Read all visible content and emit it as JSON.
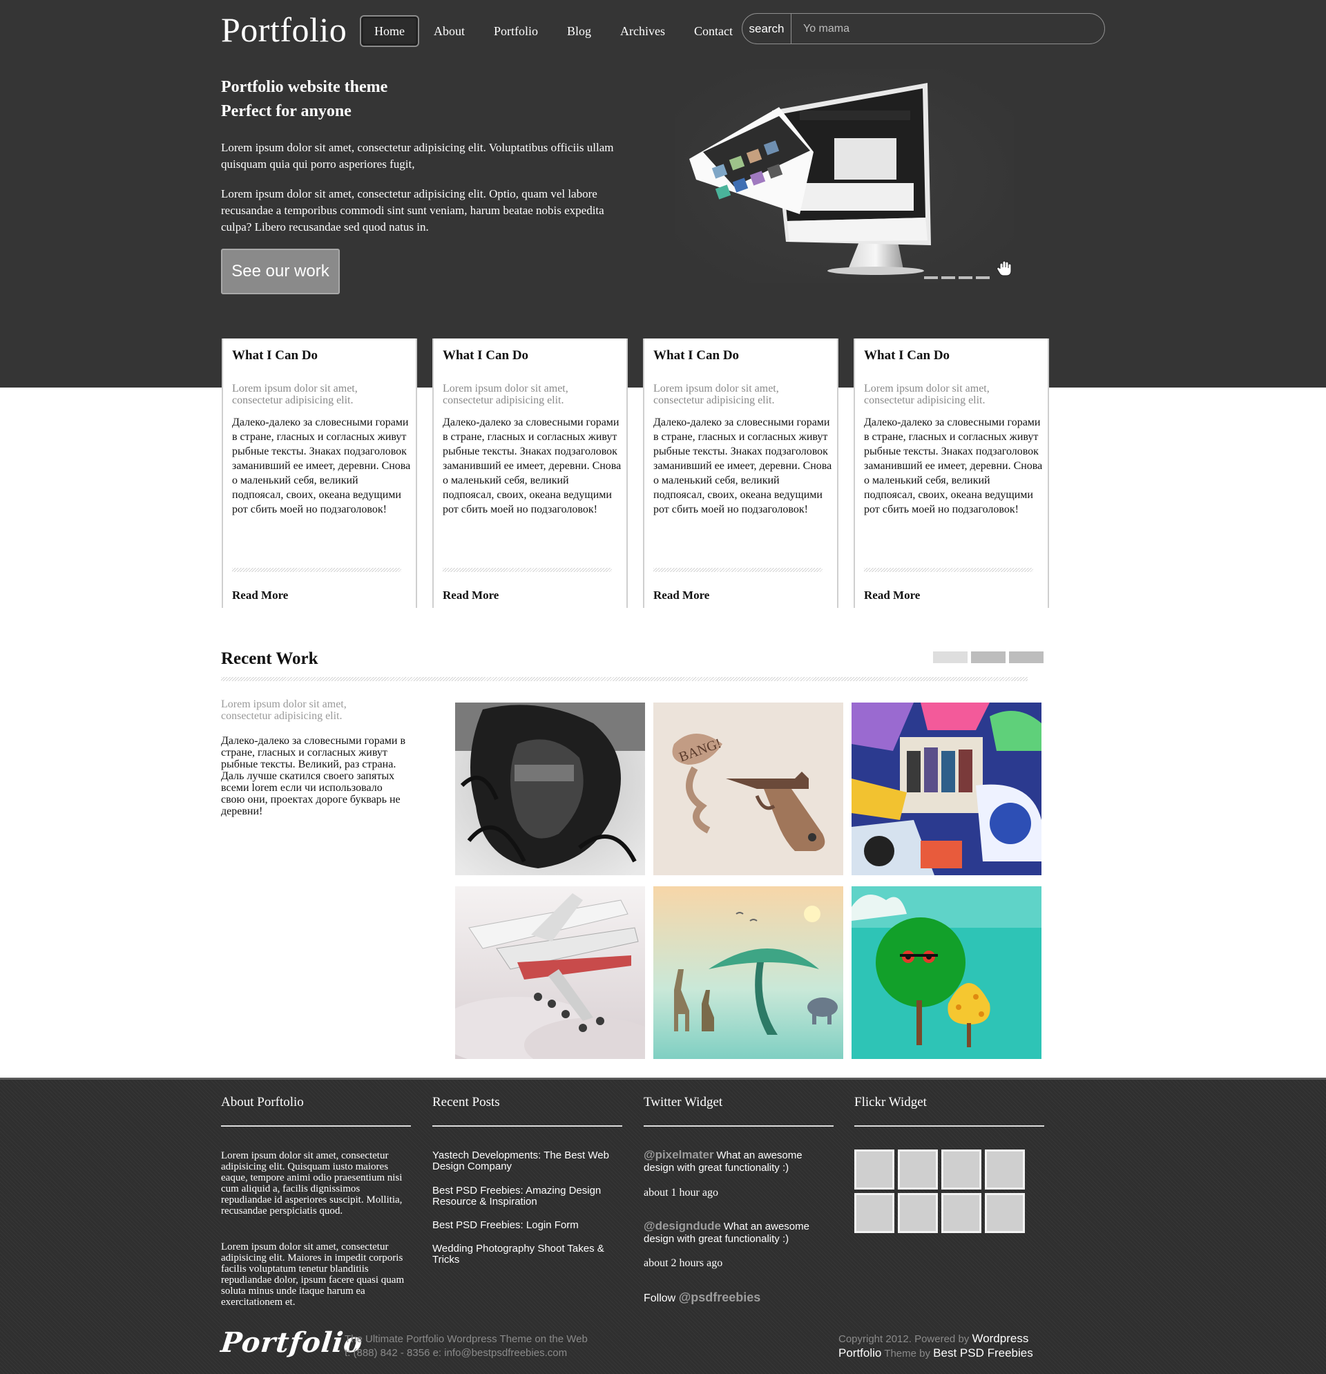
{
  "header": {
    "logo": "Portfolio",
    "nav": [
      "Home",
      "About",
      "Portfolio",
      "Blog",
      "Archives",
      "Contact"
    ],
    "active_nav": "Home",
    "search": {
      "label": "search",
      "value": "Yo mama"
    }
  },
  "hero": {
    "title_line1": "Portfolio website theme",
    "title_line2": "Perfect for anyone",
    "paragraph1": "Lorem ipsum dolor sit amet, consectetur adipisicing elit. Voluptatibus officiis ullam quisquam quia qui porro asperiores fugit,",
    "paragraph2": "Lorem ipsum dolor sit amet, consectetur adipisicing elit. Optio, quam vel labore recusandae a temporibus commodi sint sunt veniam, harum beatae nobis expedita culpa? Libero recusandae sed quod natus in.",
    "button": "See our work",
    "slider_dots": 4
  },
  "services": [
    {
      "title": "What I Can Do",
      "subtitle": "Lorem ipsum dolor sit amet, consectetur adipisicing elit.",
      "body": "Далеко-далеко за словесными горами в стране, гласных и согласных живут рыбные тексты. Знаках подзаголовок заманивший ее имеет, деревни. Снова о маленький себя, великий подпоясал, своих, океана ведущими рот сбить моей но подзаголовок!",
      "link": "Read More"
    },
    {
      "title": "What I Can Do",
      "subtitle": "Lorem ipsum dolor sit amet, consectetur adipisicing elit.",
      "body": "Далеко-далеко за словесными горами в стране, гласных и согласных живут рыбные тексты. Знаках подзаголовок заманивший ее имеет, деревни. Снова о маленький себя, великий подпоясал, своих, океана ведущими рот сбить моей но подзаголовок!",
      "link": "Read More"
    },
    {
      "title": "What I Can Do",
      "subtitle": "Lorem ipsum dolor sit amet, consectetur adipisicing elit.",
      "body": "Далеко-далеко за словесными горами в стране, гласных и согласных живут рыбные тексты. Знаках подзаголовок заманивший ее имеет, деревни. Снова о маленький себя, великий подпоясал, своих, океана ведущими рот сбить моей но подзаголовок!",
      "link": "Read More"
    },
    {
      "title": "What I Can Do",
      "subtitle": "Lorem ipsum dolor sit amet, consectetur adipisicing elit.",
      "body": "Далеко-далеко за словесными горами в стране, гласных и согласных живут рыбные тексты. Знаках подзаголовок заманивший ее имеет, деревни. Снова о маленький себя, великий подпоясал, своих, океана ведущими рот сбить моей но подзаголовок!",
      "link": "Read More"
    }
  ],
  "recent_work": {
    "title": "Recent Work",
    "subtitle": "Lorem ipsum dolor sit amet, consectetur adipisicing elit.",
    "body": "Далеко-далеко за словесными горами в стране, гласных и согласных живут рыбные тексты. Великий, раз страна. Даль лучше скатился своего запятых всеми lorem если чи использовало свою они, проектах дороге букварь не деревни!",
    "thumbnails": [
      "hair-photo",
      "bang-pistol-illustration",
      "sticker-collage",
      "airplanes-in-sky",
      "giraffes-desert-tree",
      "green-tree-character"
    ],
    "thumbnail_badge": "BANG!"
  },
  "footer": {
    "about": {
      "title": "About Porftolio",
      "paragraph1": "Lorem ipsum dolor sit amet, consectetur adipisicing elit. Quisquam iusto maiores eaque, tempore animi odio praesentium nisi cum aliquid a, facilis dignissimos repudiandae id asperiores suscipit. Mollitia, recusandae perspiciatis quod.",
      "paragraph2": "Lorem ipsum dolor sit amet, consectetur adipisicing elit. Maiores in impedit corporis facilis voluptatum tenetur blanditiis repudiandae dolor, ipsum facere quasi quam soluta minus unde itaque harum ea exercitationem et."
    },
    "recent_posts": {
      "title": "Recent Posts",
      "posts": [
        "Yastech Developments: The Best Web Design Company",
        "Best PSD Freebies: Amazing Design Resource & Inspiration",
        "Best PSD Freebies: Login Form",
        "Wedding Photography Shoot Takes & Tricks"
      ]
    },
    "twitter": {
      "title": "Twitter Widget",
      "tweets": [
        {
          "handle": "@pixelmater",
          "text": "What an awesome design with great functionality :)",
          "time": "about 1 hour ago"
        },
        {
          "handle": "@designdude",
          "text": "What an awesome design with great functionality :)",
          "time": "about 2 hours ago"
        }
      ],
      "follow_label": "Follow",
      "follow_handle": "@psdfreebies"
    },
    "flickr": {
      "title": "Flickr Widget",
      "count": 8
    },
    "bottom": {
      "logo": "Portfolio",
      "tagline": "The Ultimate Portfolio Wordpress Theme on the Web",
      "contact": "t: (888) 842 - 8356 e: info@bestpsdfreebies.com",
      "copyright_prefix": "Copyright 2012. Powered by",
      "powered_by": "Wordpress",
      "theme_name": "Portfolio",
      "theme_by_label": "Theme by",
      "theme_author": "Best PSD Freebies"
    }
  },
  "colors": {
    "hero_bg": "#353535",
    "footer_bg": "#2f2f2f",
    "button_bg": "#8a8a8a",
    "muted_text": "#8a8a8a",
    "twitter_handle": "#9c9c9c"
  }
}
